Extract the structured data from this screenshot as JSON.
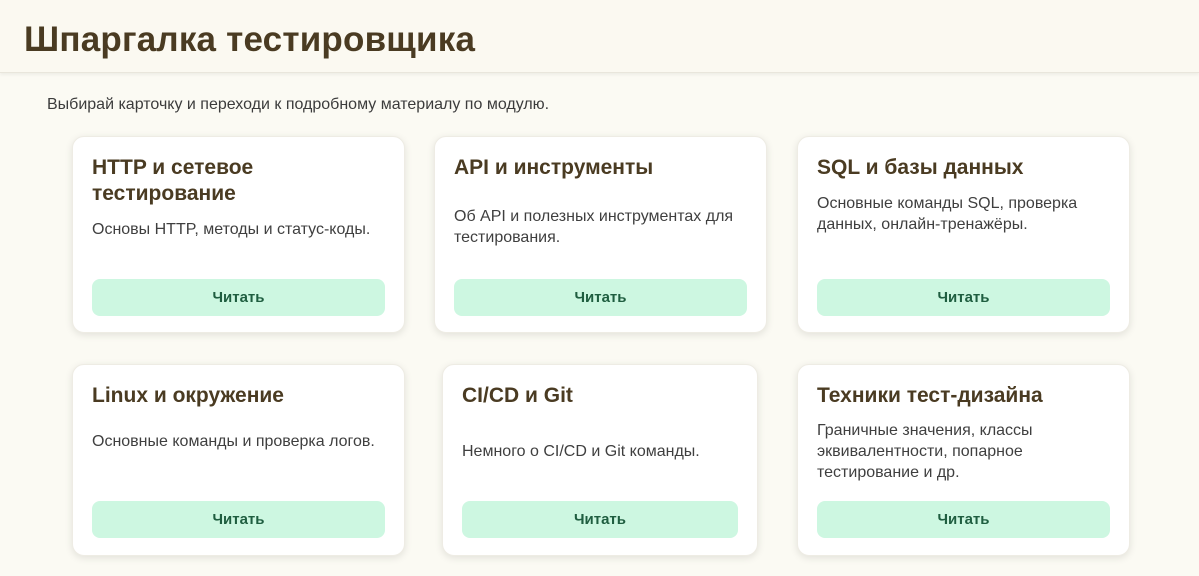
{
  "header": {
    "title": "Шпаргалка тестировщика"
  },
  "intro": "Выбирай карточку и переходи к подробному материалу по модулю.",
  "cards": [
    {
      "title": "HTTP и сетевое тестирование",
      "description": "Основы HTTP, методы и статус-коды.",
      "button": "Читать"
    },
    {
      "title": "API и инструменты",
      "description": "Об API и полезных инструментах для тестирования.",
      "button": "Читать"
    },
    {
      "title": "SQL и базы данных",
      "description": "Основные команды SQL, проверка данных, онлайн-тренажёры.",
      "button": "Читать"
    },
    {
      "title": "Linux и окружение",
      "description": "Основные команды и проверка логов.",
      "button": "Читать"
    },
    {
      "title": "CI/CD и Git",
      "description": "Немного о CI/CD и Git команды.",
      "button": "Читать"
    },
    {
      "title": "Техники тест-дизайна",
      "description": "Граничные значения, классы эквивалентности, попарное тестирование и др.",
      "button": "Читать"
    }
  ],
  "colors": {
    "accent": "#cdf7e1",
    "title_text": "#4a3b22",
    "button_text": "#1f5e40",
    "background": "#fbfaf3"
  }
}
